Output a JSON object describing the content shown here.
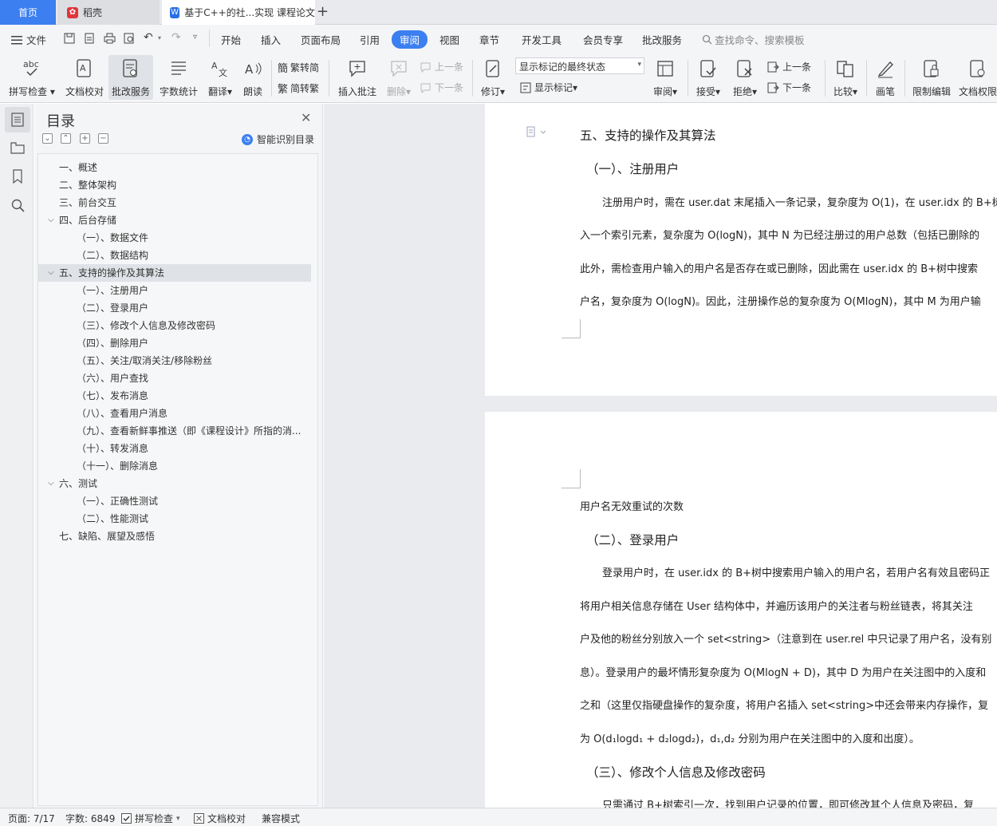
{
  "tabs": {
    "home": "首页",
    "daoke": "稻壳",
    "doc": "基于C++的社...实现 课程论文"
  },
  "menu": {
    "file": "文件",
    "items": [
      "开始",
      "插入",
      "页面布局",
      "引用",
      "审阅",
      "视图",
      "章节",
      "开发工具",
      "会员专享",
      "批改服务"
    ],
    "active": "审阅",
    "search": "查找命令、搜索模板"
  },
  "toolbar": {
    "spell": "拼写检查",
    "doc_check": "文档校对",
    "review_service": "批改服务",
    "word_count": "字数统计",
    "translate": "翻译",
    "read_aloud": "朗读",
    "to_simplified": "繁转简",
    "to_traditional": "简转繁",
    "insert_comment": "插入批注",
    "delete": "删除",
    "prev_comment": "上一条",
    "next_comment": "下一条",
    "track": "修订",
    "markup_state": "显示标记的最终状态",
    "show_markup": "显示标记",
    "review": "审阅",
    "accept": "接受",
    "reject": "拒绝",
    "prev_change": "上一条",
    "next_change": "下一条",
    "compare": "比较",
    "pen": "画笔",
    "restrict": "限制编辑",
    "doc_perm": "文档权限"
  },
  "toc": {
    "title": "目录",
    "smart": "智能识别目录",
    "items": [
      {
        "text": "一、概述",
        "level": 1
      },
      {
        "text": "二、整体架构",
        "level": 1
      },
      {
        "text": "三、前台交互",
        "level": 1
      },
      {
        "text": "四、后台存储",
        "level": 1,
        "expanded": true
      },
      {
        "text": "（一）、数据文件",
        "level": 2
      },
      {
        "text": "（二）、数据结构",
        "level": 2
      },
      {
        "text": "五、支持的操作及其算法",
        "level": 1,
        "expanded": true,
        "selected": true
      },
      {
        "text": "（一）、注册用户",
        "level": 2
      },
      {
        "text": "（二）、登录用户",
        "level": 2
      },
      {
        "text": "（三）、修改个人信息及修改密码",
        "level": 2
      },
      {
        "text": "（四）、删除用户",
        "level": 2
      },
      {
        "text": "（五）、关注/取消关注/移除粉丝",
        "level": 2
      },
      {
        "text": "（六）、用户查找",
        "level": 2
      },
      {
        "text": "（七）、发布消息",
        "level": 2
      },
      {
        "text": "（八）、查看用户消息",
        "level": 2
      },
      {
        "text": "（九）、查看新鲜事推送（即《课程设计》所指的消...",
        "level": 2
      },
      {
        "text": "（十）、转发消息",
        "level": 2
      },
      {
        "text": "（十一）、删除消息",
        "level": 2
      },
      {
        "text": "六、测试",
        "level": 1,
        "expanded": true
      },
      {
        "text": "（一）、正确性测试",
        "level": 2
      },
      {
        "text": "（二）、性能测试",
        "level": 2
      },
      {
        "text": "七、缺陷、展望及感悟",
        "level": 1
      }
    ]
  },
  "document": {
    "page1": {
      "heading": "五、支持的操作及其算法",
      "sub": "（一）、注册用户",
      "lines": [
        "注册用户时，需在 user.dat 末尾插入一条记录，复杂度为 O(1)，在 user.idx 的 B+树",
        "入一个索引元素，复杂度为 O(logN)，其中 N 为已经注册过的用户总数（包括已删除的",
        "此外，需检查用户输入的用户名是否存在或已删除，因此需在 user.idx 的 B+树中搜索",
        "户名，复杂度为 O(logN)。因此，注册操作总的复杂度为 O(MlogN)，其中 M 为用户输"
      ]
    },
    "page2": {
      "first_line": "用户名无效重试的次数",
      "sub": "（二）、登录用户",
      "lines": [
        "登录用户时，在 user.idx 的 B+树中搜索用户输入的用户名，若用户名有效且密码正",
        "将用户相关信息存储在 User 结构体中，并遍历该用户的关注者与粉丝链表，将其关注",
        "户及他的粉丝分别放入一个 set<string>（注意到在 user.rel 中只记录了用户名，没有别",
        "息）。登录用户的最坏情形复杂度为 O(MlogN + D)，其中 D 为用户在关注图中的入度和",
        "之和（这里仅指硬盘操作的复杂度，将用户名插入 set<string>中还会带来内存操作，复",
        "为 O(d₁logd₁ + d₂logd₂)，d₁,d₂ 分别为用户在关注图中的入度和出度）。"
      ],
      "sub2": "（三）、修改个人信息及修改密码",
      "last_line": "只需通过 B+树索引一次，找到用户记录的位置，即可修改其个人信息及密码，复"
    }
  },
  "status": {
    "page": "页面: 7/17",
    "words": "字数: 6849",
    "spell": "拼写检查",
    "doc_check": "文档校对",
    "compat": "兼容模式"
  },
  "colors": {
    "accent": "#3c7ff0",
    "ui_bg": "#f4f5f7",
    "doc_gap": "#e9ebee"
  }
}
